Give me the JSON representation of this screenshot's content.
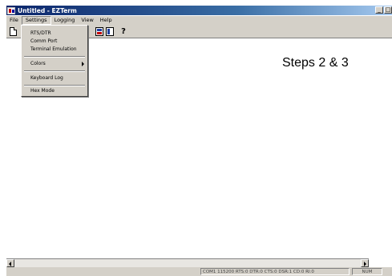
{
  "window": {
    "title": "Untitled - EZTerm",
    "minimize_label": "_",
    "maximize_label": "□"
  },
  "menubar": {
    "items": [
      "File",
      "Settings",
      "Logging",
      "View",
      "Help"
    ]
  },
  "settings_menu": {
    "items": [
      {
        "label": "RTS/DTR"
      },
      {
        "label": "Comm Port"
      },
      {
        "label": "Terminal Emulation"
      },
      {
        "label": "Colors",
        "submenu": true
      },
      {
        "label": "Keyboard Log"
      },
      {
        "label": "Hex Mode"
      }
    ]
  },
  "toolbar": {
    "help_glyph": "?"
  },
  "overlay": {
    "text": "Steps 2 & 3"
  },
  "statusbar": {
    "main": "COM1 115200 RTS:0 DTR:0 CTS:0 DSR:1 CD:0 RI:0",
    "num": "NUM"
  },
  "colors": {
    "title_bar": "#0a246a",
    "chrome": "#d4d0c8"
  }
}
